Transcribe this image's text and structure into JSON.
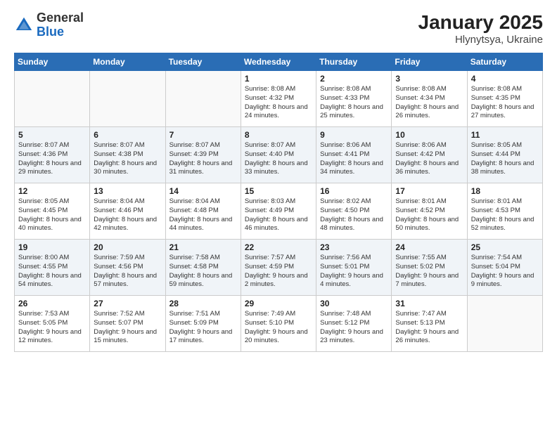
{
  "header": {
    "logo_general": "General",
    "logo_blue": "Blue",
    "month_year": "January 2025",
    "location": "Hlynytsya, Ukraine"
  },
  "weekdays": [
    "Sunday",
    "Monday",
    "Tuesday",
    "Wednesday",
    "Thursday",
    "Friday",
    "Saturday"
  ],
  "weeks": [
    [
      {
        "day": "",
        "sunrise": "",
        "sunset": "",
        "daylight": ""
      },
      {
        "day": "",
        "sunrise": "",
        "sunset": "",
        "daylight": ""
      },
      {
        "day": "",
        "sunrise": "",
        "sunset": "",
        "daylight": ""
      },
      {
        "day": "1",
        "sunrise": "Sunrise: 8:08 AM",
        "sunset": "Sunset: 4:32 PM",
        "daylight": "Daylight: 8 hours and 24 minutes."
      },
      {
        "day": "2",
        "sunrise": "Sunrise: 8:08 AM",
        "sunset": "Sunset: 4:33 PM",
        "daylight": "Daylight: 8 hours and 25 minutes."
      },
      {
        "day": "3",
        "sunrise": "Sunrise: 8:08 AM",
        "sunset": "Sunset: 4:34 PM",
        "daylight": "Daylight: 8 hours and 26 minutes."
      },
      {
        "day": "4",
        "sunrise": "Sunrise: 8:08 AM",
        "sunset": "Sunset: 4:35 PM",
        "daylight": "Daylight: 8 hours and 27 minutes."
      }
    ],
    [
      {
        "day": "5",
        "sunrise": "Sunrise: 8:07 AM",
        "sunset": "Sunset: 4:36 PM",
        "daylight": "Daylight: 8 hours and 29 minutes."
      },
      {
        "day": "6",
        "sunrise": "Sunrise: 8:07 AM",
        "sunset": "Sunset: 4:38 PM",
        "daylight": "Daylight: 8 hours and 30 minutes."
      },
      {
        "day": "7",
        "sunrise": "Sunrise: 8:07 AM",
        "sunset": "Sunset: 4:39 PM",
        "daylight": "Daylight: 8 hours and 31 minutes."
      },
      {
        "day": "8",
        "sunrise": "Sunrise: 8:07 AM",
        "sunset": "Sunset: 4:40 PM",
        "daylight": "Daylight: 8 hours and 33 minutes."
      },
      {
        "day": "9",
        "sunrise": "Sunrise: 8:06 AM",
        "sunset": "Sunset: 4:41 PM",
        "daylight": "Daylight: 8 hours and 34 minutes."
      },
      {
        "day": "10",
        "sunrise": "Sunrise: 8:06 AM",
        "sunset": "Sunset: 4:42 PM",
        "daylight": "Daylight: 8 hours and 36 minutes."
      },
      {
        "day": "11",
        "sunrise": "Sunrise: 8:05 AM",
        "sunset": "Sunset: 4:44 PM",
        "daylight": "Daylight: 8 hours and 38 minutes."
      }
    ],
    [
      {
        "day": "12",
        "sunrise": "Sunrise: 8:05 AM",
        "sunset": "Sunset: 4:45 PM",
        "daylight": "Daylight: 8 hours and 40 minutes."
      },
      {
        "day": "13",
        "sunrise": "Sunrise: 8:04 AM",
        "sunset": "Sunset: 4:46 PM",
        "daylight": "Daylight: 8 hours and 42 minutes."
      },
      {
        "day": "14",
        "sunrise": "Sunrise: 8:04 AM",
        "sunset": "Sunset: 4:48 PM",
        "daylight": "Daylight: 8 hours and 44 minutes."
      },
      {
        "day": "15",
        "sunrise": "Sunrise: 8:03 AM",
        "sunset": "Sunset: 4:49 PM",
        "daylight": "Daylight: 8 hours and 46 minutes."
      },
      {
        "day": "16",
        "sunrise": "Sunrise: 8:02 AM",
        "sunset": "Sunset: 4:50 PM",
        "daylight": "Daylight: 8 hours and 48 minutes."
      },
      {
        "day": "17",
        "sunrise": "Sunrise: 8:01 AM",
        "sunset": "Sunset: 4:52 PM",
        "daylight": "Daylight: 8 hours and 50 minutes."
      },
      {
        "day": "18",
        "sunrise": "Sunrise: 8:01 AM",
        "sunset": "Sunset: 4:53 PM",
        "daylight": "Daylight: 8 hours and 52 minutes."
      }
    ],
    [
      {
        "day": "19",
        "sunrise": "Sunrise: 8:00 AM",
        "sunset": "Sunset: 4:55 PM",
        "daylight": "Daylight: 8 hours and 54 minutes."
      },
      {
        "day": "20",
        "sunrise": "Sunrise: 7:59 AM",
        "sunset": "Sunset: 4:56 PM",
        "daylight": "Daylight: 8 hours and 57 minutes."
      },
      {
        "day": "21",
        "sunrise": "Sunrise: 7:58 AM",
        "sunset": "Sunset: 4:58 PM",
        "daylight": "Daylight: 8 hours and 59 minutes."
      },
      {
        "day": "22",
        "sunrise": "Sunrise: 7:57 AM",
        "sunset": "Sunset: 4:59 PM",
        "daylight": "Daylight: 9 hours and 2 minutes."
      },
      {
        "day": "23",
        "sunrise": "Sunrise: 7:56 AM",
        "sunset": "Sunset: 5:01 PM",
        "daylight": "Daylight: 9 hours and 4 minutes."
      },
      {
        "day": "24",
        "sunrise": "Sunrise: 7:55 AM",
        "sunset": "Sunset: 5:02 PM",
        "daylight": "Daylight: 9 hours and 7 minutes."
      },
      {
        "day": "25",
        "sunrise": "Sunrise: 7:54 AM",
        "sunset": "Sunset: 5:04 PM",
        "daylight": "Daylight: 9 hours and 9 minutes."
      }
    ],
    [
      {
        "day": "26",
        "sunrise": "Sunrise: 7:53 AM",
        "sunset": "Sunset: 5:05 PM",
        "daylight": "Daylight: 9 hours and 12 minutes."
      },
      {
        "day": "27",
        "sunrise": "Sunrise: 7:52 AM",
        "sunset": "Sunset: 5:07 PM",
        "daylight": "Daylight: 9 hours and 15 minutes."
      },
      {
        "day": "28",
        "sunrise": "Sunrise: 7:51 AM",
        "sunset": "Sunset: 5:09 PM",
        "daylight": "Daylight: 9 hours and 17 minutes."
      },
      {
        "day": "29",
        "sunrise": "Sunrise: 7:49 AM",
        "sunset": "Sunset: 5:10 PM",
        "daylight": "Daylight: 9 hours and 20 minutes."
      },
      {
        "day": "30",
        "sunrise": "Sunrise: 7:48 AM",
        "sunset": "Sunset: 5:12 PM",
        "daylight": "Daylight: 9 hours and 23 minutes."
      },
      {
        "day": "31",
        "sunrise": "Sunrise: 7:47 AM",
        "sunset": "Sunset: 5:13 PM",
        "daylight": "Daylight: 9 hours and 26 minutes."
      },
      {
        "day": "",
        "sunrise": "",
        "sunset": "",
        "daylight": ""
      }
    ]
  ]
}
